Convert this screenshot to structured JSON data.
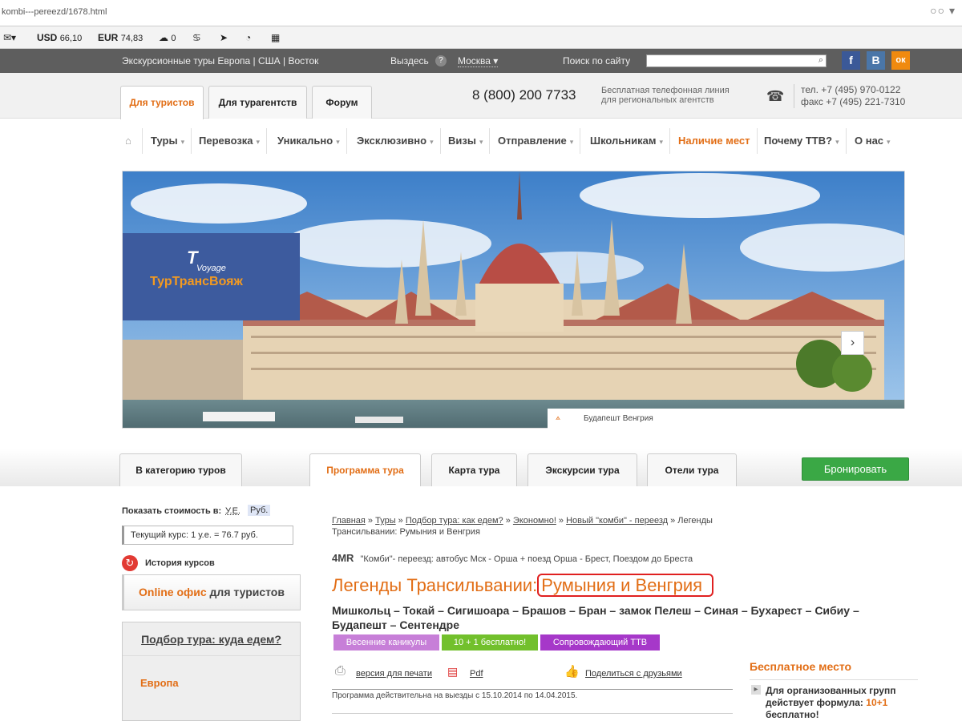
{
  "browser": {
    "url": "kombi---pereezd/1678.html"
  },
  "ext": {
    "usd_label": "USD",
    "usd_value": "66,10",
    "eur_label": "EUR",
    "eur_value": "74,83",
    "weather_value": "0"
  },
  "topbar": {
    "links": "Экскурсионные туры Европа | США | Восток",
    "vydezd": "Выздесь",
    "q": "?",
    "city": "Москва",
    "search_label": "Поиск по сайту"
  },
  "social": {
    "fb": "f",
    "vk": "B",
    "ok": "ок"
  },
  "header": {
    "tabs": [
      "Для туристов",
      "Для турагентств",
      "Форум"
    ],
    "phone": "8 (800) 200 7733",
    "hotline": "Бесплатная телефонная линия для региональных агентств",
    "tel": "тел. +7 (495) 970-0122",
    "fax": "факс +7 (495) 221-7310"
  },
  "nav": {
    "items": [
      "Туры",
      "Перевозка",
      "Уникально",
      "Эксклюзивно",
      "Визы",
      "Отправление",
      "Школьникам",
      "Наличие мест",
      "Почему ТТВ?",
      "О нас"
    ]
  },
  "banner": {
    "caption": "Будапешт Венгрия",
    "logo_small": "Voyage",
    "logo_name": "ТурТрансВояж",
    "next": "›"
  },
  "page_tabs": {
    "category": "В категорию туров",
    "program": "Программа тура",
    "map": "Карта тура",
    "excursions": "Экскурсии тура",
    "hotels": "Отели тура",
    "book": "Бронировать"
  },
  "left": {
    "show_cost": "Показать стоимость в:",
    "ue": "У.Е.",
    "rub": "Руб.",
    "rate": "Текущий курс: 1 у.е. = 76.7 руб.",
    "history": "История курсов",
    "online1": "Online офис",
    "online2": "для туристов",
    "pick": "Подбор тура: куда едем?",
    "europe": "Европа"
  },
  "breadcrumb": {
    "items": [
      "Главная",
      "Туры",
      "Подбор тура: как едем?",
      "Экономно!",
      "Новый \"комби\" - переезд"
    ],
    "current": "Легенды Трансильвании: Румыния и Венгрия"
  },
  "tour": {
    "code": "4MR",
    "transport": "\"Комби\"- переезд: автобус Мск - Орша + поезд Орша - Брест, Поездом до Бреста",
    "title_a": "Легенды Трансильвании:",
    "title_b": "Румыния и Венгрия",
    "route": "Мишкольц – Токай – Сигишоара – Брашов – Бран – замок Пелеш – Синая – Бухарест – Сибиу – Будапешт – Сентендре",
    "tags": [
      "Весенние каникулы",
      "10 + 1 бесплатно!",
      "Сопровождающий ТТВ"
    ],
    "print": "версия для печати",
    "pdf": "Pdf",
    "share": "Поделиться с друзьями",
    "validity": "Программа действительна на выезды с 15.10.2014 по 14.04.2015."
  },
  "free": {
    "title": "Бесплатное место",
    "text1": "Для организованных групп действует формула:",
    "formula": "10+1",
    "text2": "бесплатно!"
  },
  "colors": {
    "accent": "#e26e16",
    "book": "#3aa845",
    "tag1": "#c77fd8",
    "tag2": "#72c02c",
    "tag3": "#a638c9"
  }
}
